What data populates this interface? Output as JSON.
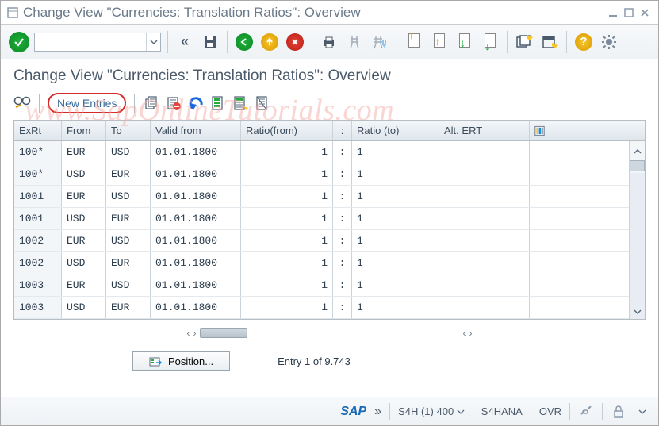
{
  "window": {
    "title": "Change View \"Currencies: Translation Ratios\": Overview"
  },
  "heading": "Change View \"Currencies: Translation Ratios\": Overview",
  "toolbar": {
    "command_value": "",
    "ok_tooltip": "Enter"
  },
  "subtoolbar": {
    "new_entries": "New Entries"
  },
  "table": {
    "columns": {
      "exrt": "ExRt",
      "from": "From",
      "to": "To",
      "valid": "Valid from",
      "rfrom": "Ratio(from)",
      "colon": ":",
      "rto": "Ratio (to)",
      "alt": "Alt. ERT"
    },
    "rows": [
      {
        "exrt": "100*",
        "from": "EUR",
        "to": "USD",
        "valid": "01.01.1800",
        "rfrom": "1",
        "colon": ":",
        "rto": "1",
        "alt": ""
      },
      {
        "exrt": "100*",
        "from": "USD",
        "to": "EUR",
        "valid": "01.01.1800",
        "rfrom": "1",
        "colon": ":",
        "rto": "1",
        "alt": ""
      },
      {
        "exrt": "1001",
        "from": "EUR",
        "to": "USD",
        "valid": "01.01.1800",
        "rfrom": "1",
        "colon": ":",
        "rto": "1",
        "alt": ""
      },
      {
        "exrt": "1001",
        "from": "USD",
        "to": "EUR",
        "valid": "01.01.1800",
        "rfrom": "1",
        "colon": ":",
        "rto": "1",
        "alt": ""
      },
      {
        "exrt": "1002",
        "from": "EUR",
        "to": "USD",
        "valid": "01.01.1800",
        "rfrom": "1",
        "colon": ":",
        "rto": "1",
        "alt": ""
      },
      {
        "exrt": "1002",
        "from": "USD",
        "to": "EUR",
        "valid": "01.01.1800",
        "rfrom": "1",
        "colon": ":",
        "rto": "1",
        "alt": ""
      },
      {
        "exrt": "1003",
        "from": "EUR",
        "to": "USD",
        "valid": "01.01.1800",
        "rfrom": "1",
        "colon": ":",
        "rto": "1",
        "alt": ""
      },
      {
        "exrt": "1003",
        "from": "USD",
        "to": "EUR",
        "valid": "01.01.1800",
        "rfrom": "1",
        "colon": ":",
        "rto": "1",
        "alt": ""
      }
    ]
  },
  "position": {
    "button_label": "Position...",
    "entry_text": "Entry 1 of 9.743"
  },
  "statusbar": {
    "system": "S4H (1) 400",
    "server": "S4HANA",
    "mode": "OVR",
    "sap": "SAP"
  },
  "watermark": "www.SapOnlineTutorials.com"
}
